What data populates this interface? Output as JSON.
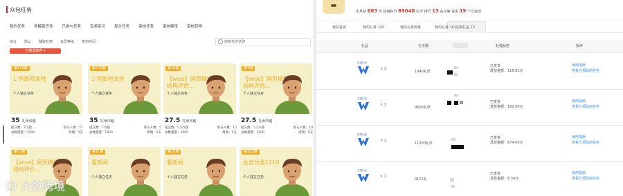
{
  "left": {
    "title": "众包任务",
    "category_tabs": [
      "我的任务",
      "待解锁任务",
      "已参与任务",
      "有奖练习",
      "部分任务",
      "审核任务",
      "审核案宝",
      "审核转移"
    ],
    "sort_items": [
      "综合",
      "默认",
      "赚取礼物",
      "会员等级",
      "发布时间"
    ],
    "search_placeholder": "搜索任务名称",
    "filter_button": "已筛选条件 ▾",
    "cards": [
      {
        "tag": "第174期",
        "title": "1-判断相关性",
        "subtitle": "个人独立任务",
        "price": "35",
        "unit": "礼币/5题",
        "l1": "提交数：7/5题",
        "r1": "参与人数：27",
        "l2": "总数量量：2000",
        "r2": "周期：5天"
      },
      {
        "tag": "第171期",
        "title": "1-判断相关性",
        "subtitle": "个人独立任务",
        "price": "35",
        "unit": "礼币/5题",
        "l1": "提交数：7/5题",
        "r1": "参与人数：5",
        "l2": "总数量量：1000",
        "r2": "周期：5天"
      },
      {
        "tag": "第16期",
        "title": "【wise】网页摘要结构评估...",
        "subtitle": "个人独立任务",
        "price": "27.5",
        "unit": "礼币/5题",
        "l1": "提交数：5.5/5题",
        "r1": "参与人数：15",
        "l2": "总数量量：2000",
        "r2": "周期：5天"
      },
      {
        "tag": "第7期",
        "title": "【wise】网页摘要结构评估...",
        "subtitle": "个人独立任务",
        "price": "27.5",
        "unit": "礼币/5题",
        "l1": "提交数：5.5/5题",
        "r1": "参与人数：10",
        "l2": "总数量量：2000",
        "r2": "周期：5天"
      },
      {
        "tag": "第17期",
        "title": "【wise】网页摘要结构评价...",
        "subtitle": "",
        "price": "",
        "unit": "",
        "l1": "",
        "r1": "",
        "l2": "",
        "r2": ""
      },
      {
        "tag": "第11期",
        "title": "看新闻",
        "subtitle": "个人独立任务",
        "price": "",
        "unit": "",
        "l1": "",
        "r1": "",
        "l2": "",
        "r2": ""
      },
      {
        "tag": "第10期",
        "title": "看新闻",
        "subtitle": "个人独立任务",
        "price": "",
        "unit": "",
        "l1": "",
        "r1": "",
        "l2": "",
        "r2": ""
      },
      {
        "tag": "第102期",
        "title": "业务分类1210",
        "subtitle": "个人独立任务",
        "price": "",
        "unit": "",
        "l1": "",
        "r1": "",
        "l2": "",
        "r2": ""
      }
    ],
    "watermark": "☺ 大数跨境"
  },
  "right": {
    "stats": {
      "pre1": "本月获",
      "days": "683",
      "mid1": "天  获得积分",
      "points": "89048",
      "mid2": "礼币  排行",
      "rank": "13",
      "mid3": "名次第  任务",
      "tasks": "19",
      "end": "个已完成"
    },
    "tabs": [
      "我的答案",
      "我的礼券 100",
      "我的礼券数量",
      "我的礼券 161",
      "兑换礼品 13"
    ],
    "headers": [
      "礼品",
      "礼币数",
      "",
      "处理状态",
      "操作"
    ],
    "rows": [
      {
        "logo_label": "兑换礼品",
        "qty": "× 1",
        "pts": "1940礼币",
        "status": "已发货",
        "amount": "发放金额：116.92元",
        "op1": "使用指南",
        "op2": "查看已领取的任务"
      },
      {
        "logo_label": "兑换礼品",
        "qty": "× 1",
        "pts": "9600礼币",
        "status": "已发货",
        "amount": "发放金额：160.00元",
        "op1": "使用指南",
        "op2": "查看已领取的任务"
      },
      {
        "logo_label": "兑换礼品",
        "qty": "× 1",
        "pts": "11200礼币",
        "status": "已发货",
        "amount": "发放金额：674.00元",
        "op1": "使用指南",
        "op2": "查看已领取的任务"
      },
      {
        "logo_label": "兑换礼品",
        "qty": "× 1",
        "pts": "4171礼",
        "status": "已发货",
        "amount": "发放金额：8.34元",
        "op1": "使用指南",
        "op2": "查看已领取的任务"
      }
    ]
  }
}
